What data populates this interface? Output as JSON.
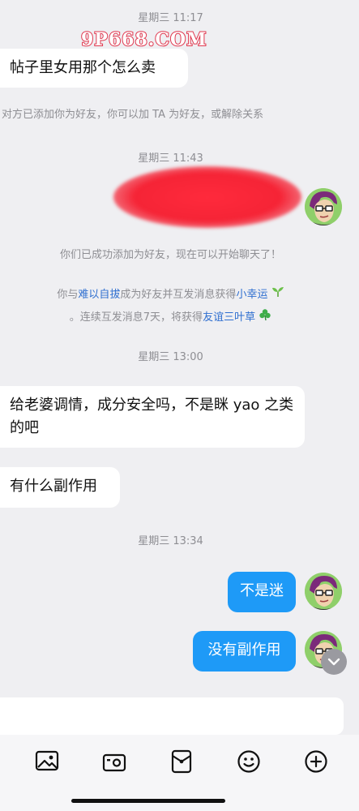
{
  "watermark": "9P668.COM",
  "timestamps": [
    "星期三 11:17",
    "星期三 11:43",
    "星期三 13:00",
    "星期三 13:34"
  ],
  "system_messages": {
    "friend_added_other": "对方已添加你为好友，你可以加 TA 为好友，或解除关系",
    "friend_added_success": "你们已成功添加为好友，现在可以开始聊天了！",
    "streak_line1_prefix": "你与",
    "streak_contact_name": "难以自拔",
    "streak_line1_middle": "成为好友并互发消息获得",
    "streak_badge_1": "小幸运",
    "streak_line2_prefix": "。连续互发消息7天，将获得",
    "streak_badge_2": "友谊三叶草"
  },
  "messages": {
    "m1": "帖子里女用那个怎么卖",
    "m3": "给老婆调情，成分安全吗，不是眯 yao 之类的吧",
    "m4": "有什么副作用",
    "m5": "不是迷",
    "m6": "没有副作用"
  },
  "icons": {
    "seedling": "seedling-icon",
    "clover": "clover-icon",
    "scroll_down": "chevron-down-icon",
    "toolbar": [
      "image-icon",
      "camera-icon",
      "envelope-icon",
      "emoji-icon",
      "plus-icon"
    ]
  },
  "colors": {
    "background": "#efeff2",
    "self_bubble": "#1e9af7",
    "link": "#2f6fd0",
    "system_text": "#8e8e93"
  }
}
